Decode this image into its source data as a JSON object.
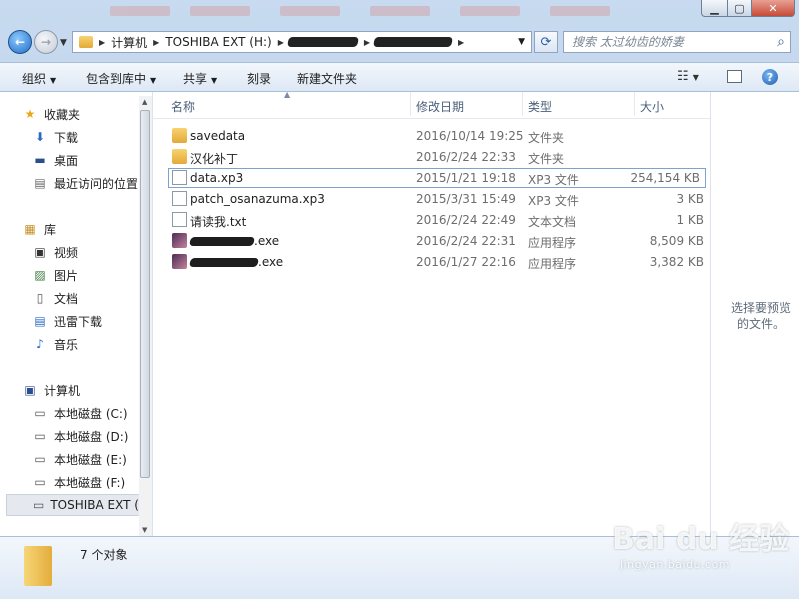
{
  "address": {
    "segments": [
      "计算机",
      "TOSHIBA EXT (H:)"
    ]
  },
  "search": {
    "placeholder": "搜索 太过幼齿的娇妻"
  },
  "toolbar": {
    "organize": "组织",
    "include_in_library": "包含到库中",
    "share": "共享",
    "burn": "刻录",
    "new_folder": "新建文件夹"
  },
  "nav": {
    "favorites": "收藏夹",
    "downloads": "下载",
    "desktop": "桌面",
    "recent": "最近访问的位置",
    "libraries": "库",
    "videos": "视频",
    "pictures": "图片",
    "documents": "文档",
    "thunder": "迅雷下载",
    "music": "音乐",
    "computer": "计算机",
    "drive_c": "本地磁盘 (C:)",
    "drive_d": "本地磁盘 (D:)",
    "drive_e": "本地磁盘 (E:)",
    "drive_f": "本地磁盘 (F:)",
    "drive_h": "TOSHIBA EXT (I"
  },
  "columns": {
    "name": "名称",
    "date": "修改日期",
    "type": "类型",
    "size": "大小"
  },
  "files": [
    {
      "name": "savedata",
      "date": "2016/10/14 19:25",
      "type": "文件夹",
      "size": ""
    },
    {
      "name": "汉化补丁",
      "date": "2016/2/24 22:33",
      "type": "文件夹",
      "size": ""
    },
    {
      "name": "data.xp3",
      "date": "2015/1/21 19:18",
      "type": "XP3 文件",
      "size": "254,154 KB"
    },
    {
      "name": "patch_osanazuma.xp3",
      "date": "2015/3/31 15:49",
      "type": "XP3 文件",
      "size": "3 KB"
    },
    {
      "name": "请读我.txt",
      "date": "2016/2/24 22:49",
      "type": "文本文档",
      "size": "1 KB"
    },
    {
      "name": ".exe",
      "date": "2016/2/24 22:31",
      "type": "应用程序",
      "size": "8,509 KB"
    },
    {
      "name": ".exe",
      "date": "2016/1/27 22:16",
      "type": "应用程序",
      "size": "3,382 KB"
    }
  ],
  "preview": {
    "text": "选择要预览的文件。"
  },
  "status": {
    "count": "7 个对象"
  },
  "watermark": {
    "brand": "Bai du 经验",
    "url": "jingyan.baidu.com"
  }
}
